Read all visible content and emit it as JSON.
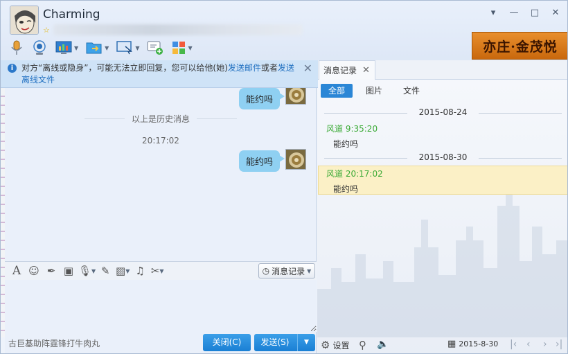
{
  "contact": {
    "name": "Charming"
  },
  "window_controls": {
    "menu": "▾",
    "minimize": "—",
    "maximize": "□",
    "close": "✕"
  },
  "ad": {
    "text": "亦庄·金茂悦"
  },
  "notice": {
    "text_before": "对方“离线或隐身”，可能无法立即回复，您可以给他(她)",
    "link_email": "发送邮件",
    "text_mid": "或者",
    "link_offline_file": "发送离线文件"
  },
  "chat": {
    "messages": [
      {
        "text": "能约吗"
      },
      {
        "text": "能约吗"
      }
    ],
    "history_separator": "以上是历史消息",
    "timestamp": "20:17:02"
  },
  "input_toolbar": {
    "history_button": "消息记录"
  },
  "bottom": {
    "ime_text": "古巨基助阵霆锋打牛肉丸",
    "close_label": "关闭(C)",
    "send_label": "发送(S)"
  },
  "history_panel": {
    "tab_label": "消息记录",
    "filters": [
      "全部",
      "图片",
      "文件"
    ],
    "groups": [
      {
        "date": "2015-08-24",
        "sender_time": "风道 9:35:20",
        "text": "能约吗"
      },
      {
        "date": "2015-08-30",
        "sender_time": "风道 20:17:02",
        "text": "能约吗"
      }
    ],
    "settings_label": "设置",
    "current_date": "2015-8-30"
  },
  "colors": {
    "accent": "#2a86d6",
    "bubble": "#8fd0f2",
    "sender": "#3aaa35",
    "highlight": "#fbf0c6"
  }
}
